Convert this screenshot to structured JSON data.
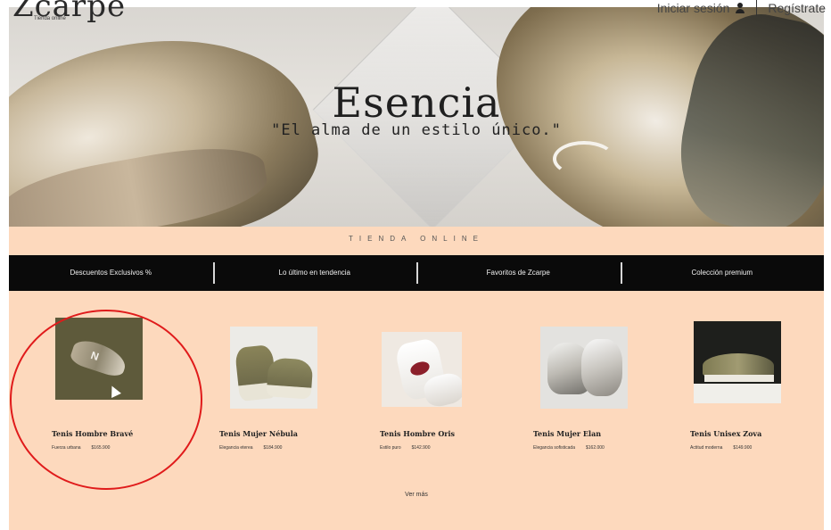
{
  "brand": {
    "logo": "Zcarpe",
    "tagline": "Tienda online"
  },
  "auth": {
    "login": "Iniciar sesión",
    "register": "Regístrate"
  },
  "hero": {
    "title": "Esencia",
    "subtitle": "\"El alma de un estilo único.\""
  },
  "store_label": "TIENDA ONLINE",
  "nav": [
    {
      "label": "Descuentos Exclusivos %"
    },
    {
      "label": "Lo último en tendencia"
    },
    {
      "label": "Favoritos de Zcarpe"
    },
    {
      "label": "Colección premium"
    }
  ],
  "products": [
    {
      "name": "Tenis Hombre Bravé",
      "description": "Fuerza urbana",
      "price": "$165.900"
    },
    {
      "name": "Tenis Mujer Nébula",
      "description": "Elegancia eterea",
      "price": "$184.900"
    },
    {
      "name": "Tenis Hombre Oris",
      "description": "Estilo puro",
      "price": "$142.900"
    },
    {
      "name": "Tenis Mujer Elan",
      "description": "Elegancia sofisticada",
      "price": "$162.000"
    },
    {
      "name": "Tenis Unisex Zova",
      "description": "Actitud moderna",
      "price": "$149.900"
    }
  ],
  "ver_mas": "Ver más",
  "colors": {
    "peach": "#fdd9bd",
    "navbar": "#0a0a0a",
    "annotation": "#e01b1b"
  }
}
